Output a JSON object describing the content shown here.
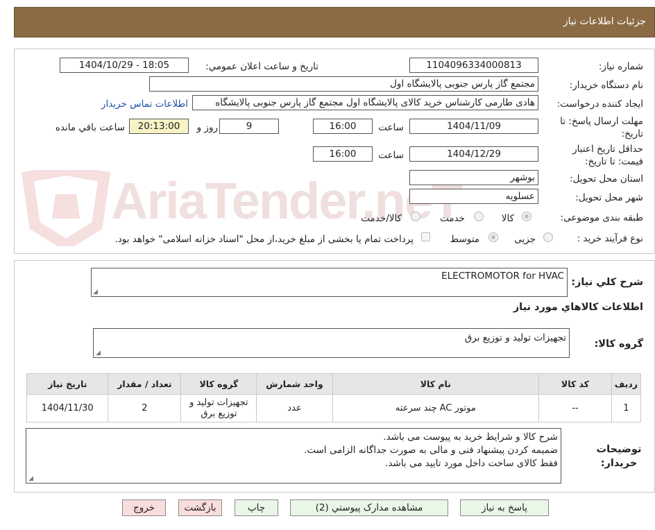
{
  "header": {
    "title": "جزئیات اطلاعات نیاز"
  },
  "form": {
    "need_number_label": "شماره نیاز:",
    "need_number_value": "1104096334000813",
    "announce_label": "تاریخ و ساعت اعلان عمومي:",
    "announce_value": "1404/10/29 - 18:05",
    "buyer_org_label": "نام دستگاه خریدار:",
    "buyer_org_value": "مجتمع گاز پارس جنوبی  پالایشگاه اول",
    "creator_label": "ایجاد کننده درخواست:",
    "creator_value": "هادی طارمی کارشناس خرید کالای پالایشگاه اول مجتمع گاز پارس جنوبی  پالایشگاه",
    "contact_link": "اطلاعات تماس خریدار",
    "deadline_label": "مهلت ارسال پاسخ: تا تاریخ:",
    "deadline_date": "1404/11/09",
    "time_label": "ساعت",
    "deadline_time": "16:00",
    "days_value": "9",
    "days_label": "روز و",
    "remaining_value": "20:13:00",
    "remaining_label": "ساعت باقي مانده",
    "validity_label": "حداقل تاريخ اعتبار قیمت: تا تاریخ:",
    "validity_date": "1404/12/29",
    "validity_time": "16:00",
    "province_label": "استان محل تحویل:",
    "province_value": "بوشهر",
    "city_label": "شهر محل تحویل:",
    "city_value": "عسلویه",
    "category_label": "طبقه بندی موضوعی:",
    "category_options": [
      "کالا",
      "خدمت",
      "کالا/خدمت"
    ],
    "purchase_type_label": "نوع فرآیند خرید :",
    "purchase_options": [
      "جزیی",
      "متوسط"
    ],
    "payment_note": "پرداخت تمام یا بخشی از مبلغ خرید،از محل \"اسناد خزانه اسلامی\" خواهد بود."
  },
  "summary": {
    "desc_label": "شرح کلي نياز:",
    "desc_value": "ELECTROMOTOR  for HVAC",
    "items_title": "اطلاعات کالاهاي مورد نياز",
    "group_label": "گروه کالا:",
    "group_value": "تجهیزات تولید و توزیع برق"
  },
  "table": {
    "headers": [
      "رديف",
      "کد کالا",
      "نام کالا",
      "واحد شمارش",
      "گروه کالا",
      "تعداد / مقدار",
      "تاريخ نياز"
    ],
    "rows": [
      [
        "1",
        "--",
        "موتور AC چند سرعته",
        "عدد",
        "تجهیزات تولید و توزیع برق",
        "2",
        "1404/11/30"
      ]
    ]
  },
  "notes": {
    "label": "توضيحات خريدار:",
    "lines": [
      "شرح کالا و شرایط خرید به پیوست می باشد.",
      "ضمیمه کردن پیشنهاد فنی و مالی به صورت جداگانه الزامی است.",
      "فقط کالای ساخت داخل مورد تایید می باشد."
    ]
  },
  "buttons": {
    "reply": "پاسخ به نیاز",
    "attachments": "مشاهده مدارک پیوستي (2)",
    "print": "چاپ",
    "back": "بازگشت",
    "exit": "خروج"
  },
  "watermark": {
    "text": "AriaTender.neT"
  },
  "colors": {
    "header": "#8b6b43",
    "link": "#1d4fa8",
    "yellow_box": "#f7f3c5",
    "green_button": "#e9f7e6",
    "red_button": "#f9dcdc"
  }
}
